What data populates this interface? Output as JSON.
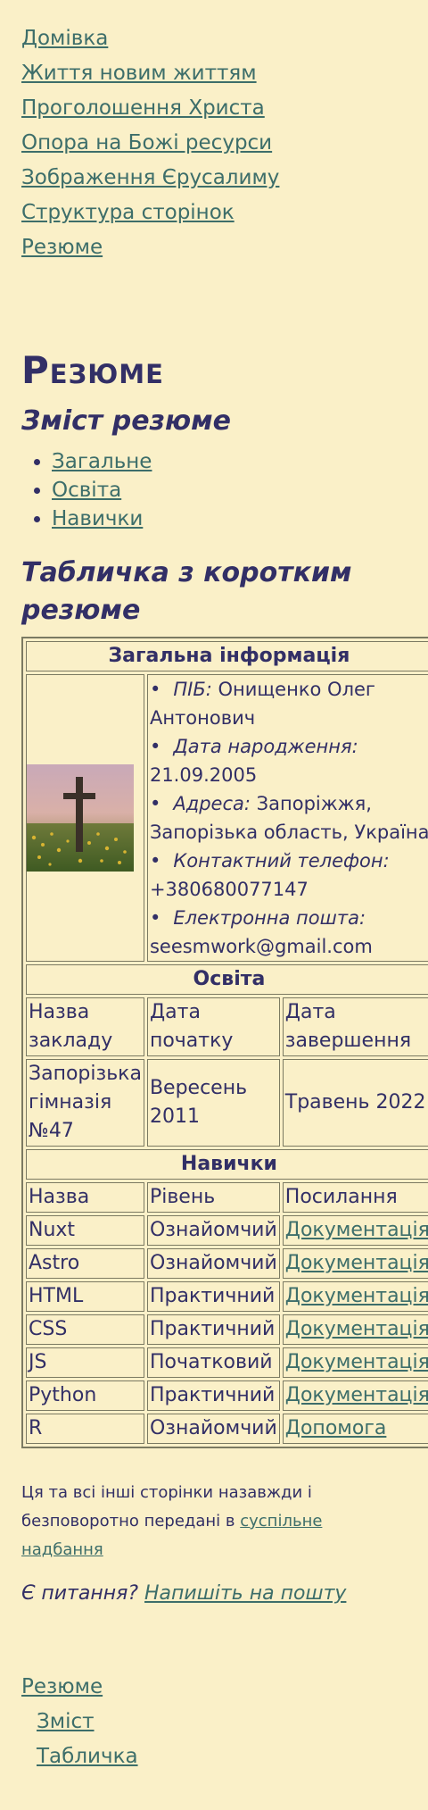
{
  "nav": {
    "items": [
      "Домівка",
      "Життя новим життям",
      "Проголошення Христа",
      "Опора на Божі ресурси",
      "Зображення Єрусалиму",
      "Структура сторінок",
      "Резюме"
    ]
  },
  "page_title": "Резюме",
  "toc": {
    "heading": "Зміст резюме",
    "items": [
      "Загальне",
      "Освіта",
      "Навички"
    ]
  },
  "table_heading": "Табличка з коротким резюме",
  "table": {
    "general_header": "Загальна інформація",
    "photo_description": "cross-in-meadow",
    "info": [
      {
        "label": "ПІБ:",
        "value": "Онищенко Олег Антонович"
      },
      {
        "label": "Дата народження:",
        "value": "21.09.2005"
      },
      {
        "label": "Адреса:",
        "value": "Запоріжжя, Запорізька область, Україна"
      },
      {
        "label": "Контактний телефон:",
        "value": "+380680077147"
      },
      {
        "label": "Електронна пошта:",
        "value": "seesmwork@gmail.com"
      }
    ],
    "education_header": "Освіта",
    "education_columns": [
      "Назва закладу",
      "Дата початку",
      "Дата завершення"
    ],
    "education_rows": [
      [
        "Запорізька гімназія №47",
        "Вересень 2011",
        "Травень 2022"
      ]
    ],
    "skills_header": "Навички",
    "skills_columns": [
      "Назва",
      "Рівень",
      "Посилання"
    ],
    "skills_rows": [
      [
        "Nuxt",
        "Ознайомчий",
        "Документація"
      ],
      [
        "Astro",
        "Ознайомчий",
        "Документація"
      ],
      [
        "HTML",
        "Практичний",
        "Документація"
      ],
      [
        "CSS",
        "Практичний",
        "Документація"
      ],
      [
        "JS",
        "Початковий",
        "Документація"
      ],
      [
        "Python",
        "Практичний",
        "Документація"
      ],
      [
        "R",
        "Ознайомчий",
        "Допомога"
      ]
    ]
  },
  "footer": {
    "license_text": "Ця та всі інші сторінки назавжди і безповоротно передані в",
    "license_link": "суспільне надбання",
    "question_text": "Є питання?",
    "question_link": "Напишіть на пошту"
  },
  "bottom_nav": {
    "root": "Резюме",
    "children": [
      "Зміст",
      "Табличка"
    ]
  },
  "colors": {
    "background": "#faf0c8",
    "text": "#322f66",
    "link": "#3d6e6a"
  }
}
